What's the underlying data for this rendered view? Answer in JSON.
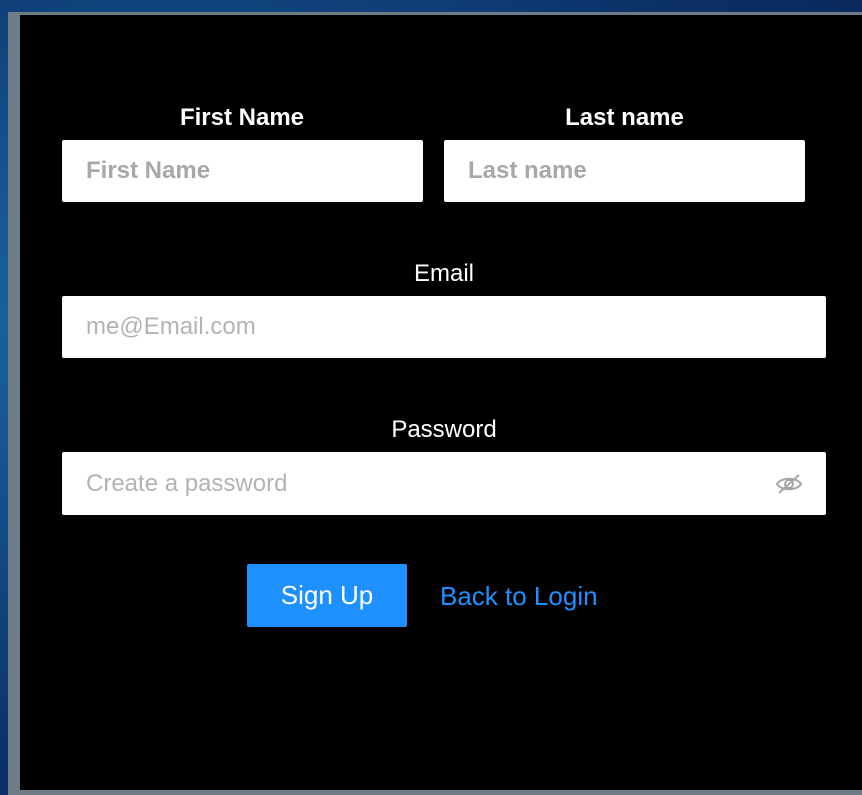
{
  "form": {
    "first_name": {
      "label": "First Name",
      "placeholder": "First Name"
    },
    "last_name": {
      "label": "Last name",
      "placeholder": "Last name"
    },
    "email": {
      "label": "Email",
      "placeholder": "me@Email.com"
    },
    "password": {
      "label": "Password",
      "placeholder": "Create a password",
      "toggle_icon": "eye-slash-icon"
    },
    "submit_label": "Sign Up",
    "back_link": "Back to Login"
  },
  "colors": {
    "panel_bg": "#000000",
    "accent": "#1e90ff",
    "input_bg": "#ffffff",
    "placeholder": "#b3b3b3"
  }
}
